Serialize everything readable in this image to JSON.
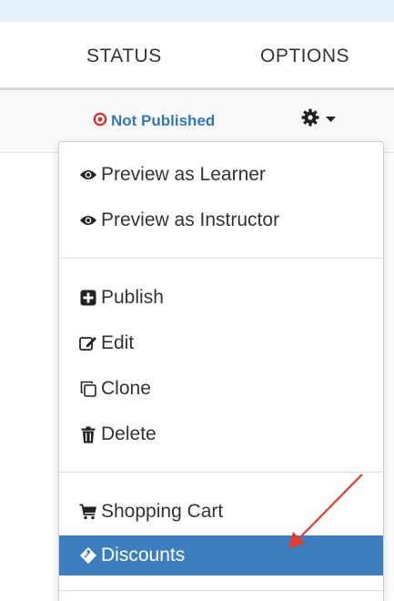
{
  "table": {
    "header_status": "STATUS",
    "header_options": "OPTIONS",
    "status_label": "Not Published"
  },
  "menu": {
    "items": [
      {
        "label": "Preview as Learner",
        "icon": "eye-icon"
      },
      {
        "label": "Preview as Instructor",
        "icon": "eye-icon"
      },
      {
        "label": "Publish",
        "icon": "plus-square-icon"
      },
      {
        "label": "Edit",
        "icon": "edit-icon"
      },
      {
        "label": "Clone",
        "icon": "clone-icon"
      },
      {
        "label": "Delete",
        "icon": "trash-icon"
      },
      {
        "label": "Shopping Cart",
        "icon": "shopping-cart-icon"
      },
      {
        "label": "Discounts",
        "icon": "tag-icon",
        "selected": true
      }
    ]
  },
  "colors": {
    "accent": "#3d7ebf",
    "status_text": "#3479b7",
    "status_icon": "#e0262f",
    "annotation_arrow": "#e53a2f"
  }
}
